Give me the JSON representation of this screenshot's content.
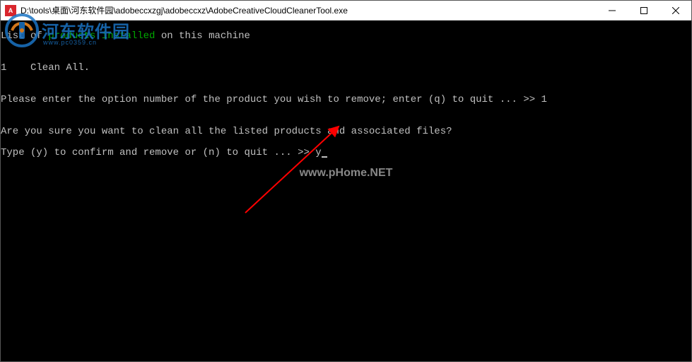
{
  "window": {
    "title": "D:\\tools\\桌面\\河东软件园\\adobeccxzgj\\adobeccxz\\AdobeCreativeCloudCleanerTool.exe",
    "icon_label": "A"
  },
  "console": {
    "line1_part1": "List of ",
    "line1_green": "products installed",
    "line1_part2": " on this machine",
    "blank": "",
    "line2": "1    Clean All.",
    "line3": "Please enter the option number of the product you wish to remove; enter (q) to quit ... >> 1",
    "line4": "Are you sure you want to clean all the listed products and associated files?",
    "line5": "Type (y) to confirm and remove or (n) to quit ... >> y"
  },
  "watermarks": {
    "logo_text": "河东软件园",
    "logo_sub": "www.pc0359.cn",
    "center": "www.pHome.NET"
  }
}
